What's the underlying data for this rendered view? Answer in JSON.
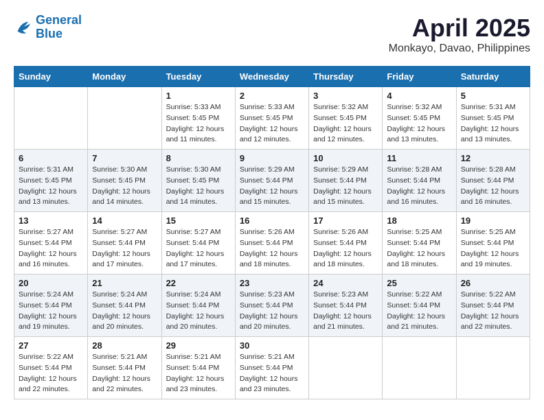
{
  "header": {
    "logo_line1": "General",
    "logo_line2": "Blue",
    "month_title": "April 2025",
    "location": "Monkayo, Davao, Philippines"
  },
  "days_of_week": [
    "Sunday",
    "Monday",
    "Tuesday",
    "Wednesday",
    "Thursday",
    "Friday",
    "Saturday"
  ],
  "weeks": [
    [
      {
        "day": "",
        "info": ""
      },
      {
        "day": "",
        "info": ""
      },
      {
        "day": "1",
        "info": "Sunrise: 5:33 AM\nSunset: 5:45 PM\nDaylight: 12 hours and 11 minutes."
      },
      {
        "day": "2",
        "info": "Sunrise: 5:33 AM\nSunset: 5:45 PM\nDaylight: 12 hours and 12 minutes."
      },
      {
        "day": "3",
        "info": "Sunrise: 5:32 AM\nSunset: 5:45 PM\nDaylight: 12 hours and 12 minutes."
      },
      {
        "day": "4",
        "info": "Sunrise: 5:32 AM\nSunset: 5:45 PM\nDaylight: 12 hours and 13 minutes."
      },
      {
        "day": "5",
        "info": "Sunrise: 5:31 AM\nSunset: 5:45 PM\nDaylight: 12 hours and 13 minutes."
      }
    ],
    [
      {
        "day": "6",
        "info": "Sunrise: 5:31 AM\nSunset: 5:45 PM\nDaylight: 12 hours and 13 minutes."
      },
      {
        "day": "7",
        "info": "Sunrise: 5:30 AM\nSunset: 5:45 PM\nDaylight: 12 hours and 14 minutes."
      },
      {
        "day": "8",
        "info": "Sunrise: 5:30 AM\nSunset: 5:45 PM\nDaylight: 12 hours and 14 minutes."
      },
      {
        "day": "9",
        "info": "Sunrise: 5:29 AM\nSunset: 5:44 PM\nDaylight: 12 hours and 15 minutes."
      },
      {
        "day": "10",
        "info": "Sunrise: 5:29 AM\nSunset: 5:44 PM\nDaylight: 12 hours and 15 minutes."
      },
      {
        "day": "11",
        "info": "Sunrise: 5:28 AM\nSunset: 5:44 PM\nDaylight: 12 hours and 16 minutes."
      },
      {
        "day": "12",
        "info": "Sunrise: 5:28 AM\nSunset: 5:44 PM\nDaylight: 12 hours and 16 minutes."
      }
    ],
    [
      {
        "day": "13",
        "info": "Sunrise: 5:27 AM\nSunset: 5:44 PM\nDaylight: 12 hours and 16 minutes."
      },
      {
        "day": "14",
        "info": "Sunrise: 5:27 AM\nSunset: 5:44 PM\nDaylight: 12 hours and 17 minutes."
      },
      {
        "day": "15",
        "info": "Sunrise: 5:27 AM\nSunset: 5:44 PM\nDaylight: 12 hours and 17 minutes."
      },
      {
        "day": "16",
        "info": "Sunrise: 5:26 AM\nSunset: 5:44 PM\nDaylight: 12 hours and 18 minutes."
      },
      {
        "day": "17",
        "info": "Sunrise: 5:26 AM\nSunset: 5:44 PM\nDaylight: 12 hours and 18 minutes."
      },
      {
        "day": "18",
        "info": "Sunrise: 5:25 AM\nSunset: 5:44 PM\nDaylight: 12 hours and 18 minutes."
      },
      {
        "day": "19",
        "info": "Sunrise: 5:25 AM\nSunset: 5:44 PM\nDaylight: 12 hours and 19 minutes."
      }
    ],
    [
      {
        "day": "20",
        "info": "Sunrise: 5:24 AM\nSunset: 5:44 PM\nDaylight: 12 hours and 19 minutes."
      },
      {
        "day": "21",
        "info": "Sunrise: 5:24 AM\nSunset: 5:44 PM\nDaylight: 12 hours and 20 minutes."
      },
      {
        "day": "22",
        "info": "Sunrise: 5:24 AM\nSunset: 5:44 PM\nDaylight: 12 hours and 20 minutes."
      },
      {
        "day": "23",
        "info": "Sunrise: 5:23 AM\nSunset: 5:44 PM\nDaylight: 12 hours and 20 minutes."
      },
      {
        "day": "24",
        "info": "Sunrise: 5:23 AM\nSunset: 5:44 PM\nDaylight: 12 hours and 21 minutes."
      },
      {
        "day": "25",
        "info": "Sunrise: 5:22 AM\nSunset: 5:44 PM\nDaylight: 12 hours and 21 minutes."
      },
      {
        "day": "26",
        "info": "Sunrise: 5:22 AM\nSunset: 5:44 PM\nDaylight: 12 hours and 22 minutes."
      }
    ],
    [
      {
        "day": "27",
        "info": "Sunrise: 5:22 AM\nSunset: 5:44 PM\nDaylight: 12 hours and 22 minutes."
      },
      {
        "day": "28",
        "info": "Sunrise: 5:21 AM\nSunset: 5:44 PM\nDaylight: 12 hours and 22 minutes."
      },
      {
        "day": "29",
        "info": "Sunrise: 5:21 AM\nSunset: 5:44 PM\nDaylight: 12 hours and 23 minutes."
      },
      {
        "day": "30",
        "info": "Sunrise: 5:21 AM\nSunset: 5:44 PM\nDaylight: 12 hours and 23 minutes."
      },
      {
        "day": "",
        "info": ""
      },
      {
        "day": "",
        "info": ""
      },
      {
        "day": "",
        "info": ""
      }
    ]
  ]
}
